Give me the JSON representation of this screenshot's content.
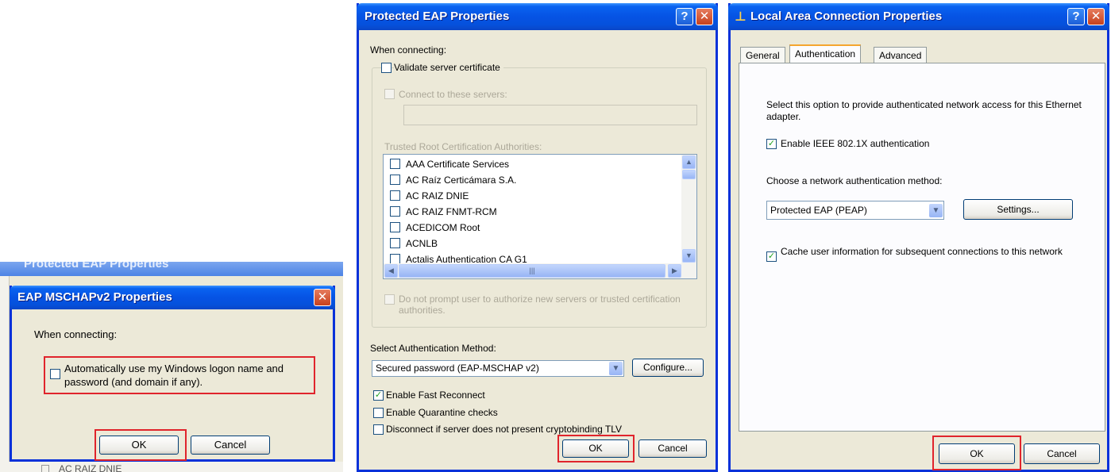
{
  "mschap": {
    "bg_title": "Protected EAP Properties",
    "bg_list_item": "AC RAIZ DNIE",
    "title": "EAP MSCHAPv2 Properties",
    "when_connecting": "When connecting:",
    "auto_logon": "Automatically use my Windows logon name and password (and domain if any).",
    "auto_logon_checked": false,
    "ok": "OK",
    "cancel": "Cancel"
  },
  "peap": {
    "title": "Protected EAP Properties",
    "when_connecting": "When connecting:",
    "validate_cert": "Validate server certificate",
    "connect_servers": "Connect to these servers:",
    "servers_value": "",
    "trusted_root": "Trusted Root Certification Authorities:",
    "cas": [
      "AAA Certificate Services",
      "AC Raíz Certicámara S.A.",
      "AC RAIZ DNIE",
      "AC RAIZ FNMT-RCM",
      "ACEDICOM Root",
      "ACNLB",
      "Actalis Authentication CA G1"
    ],
    "no_prompt": "Do not prompt user to authorize new servers or trusted certification authorities.",
    "select_method_label": "Select Authentication Method:",
    "method": "Secured password (EAP-MSCHAP v2)",
    "configure": "Configure...",
    "fast_reconnect": "Enable Fast Reconnect",
    "quarantine": "Enable Quarantine checks",
    "cryptobinding": "Disconnect if server does not present cryptobinding TLV",
    "ok": "OK",
    "cancel": "Cancel"
  },
  "lan": {
    "title": "Local Area Connection Properties",
    "tabs": [
      "General",
      "Authentication",
      "Advanced"
    ],
    "active_tab": "Authentication",
    "description": "Select this option to provide authenticated network access for this Ethernet adapter.",
    "enable_8021x": "Enable IEEE 802.1X authentication",
    "choose_method": "Choose a network authentication method:",
    "method": "Protected EAP (PEAP)",
    "settings": "Settings...",
    "cache_info": "Cache user information for subsequent connections to this network",
    "ok": "OK",
    "cancel": "Cancel"
  },
  "colors": {
    "titlebar": "#0653e4",
    "dialog_bg": "#ece9d8",
    "highlight_box": "#e0242c",
    "check": "#21a121"
  }
}
